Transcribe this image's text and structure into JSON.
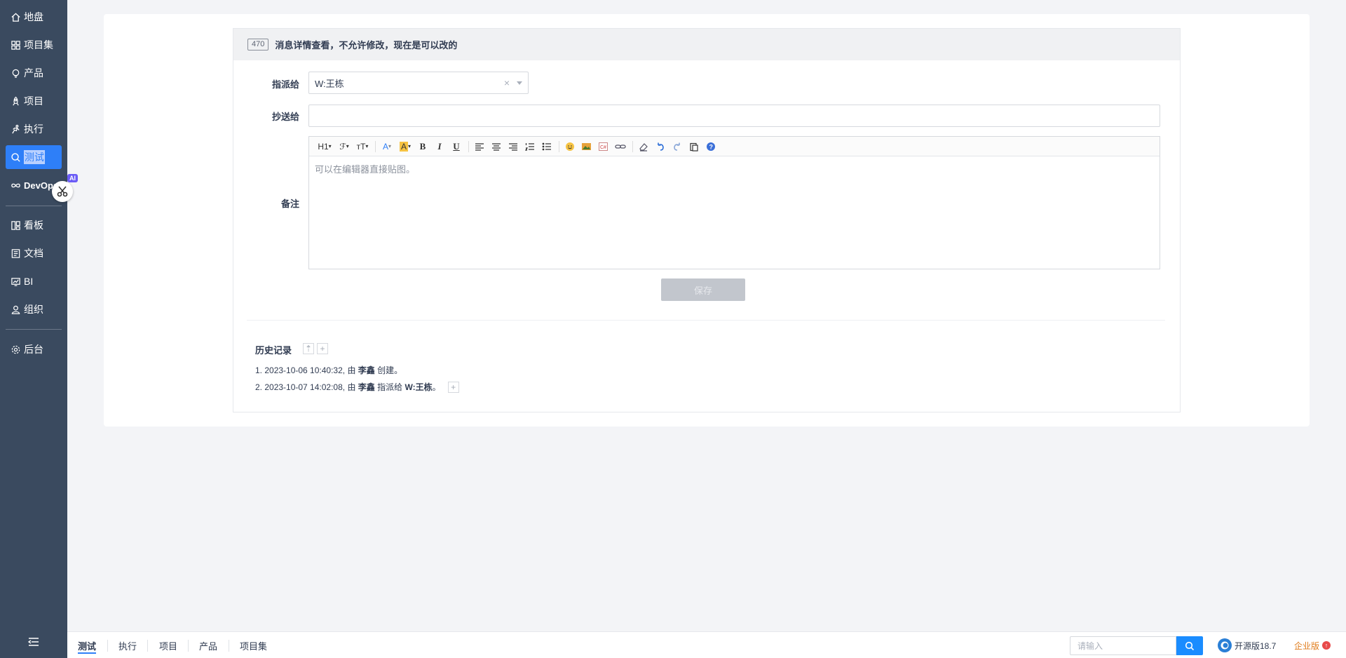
{
  "sidebar": {
    "items": [
      {
        "label": "地盘",
        "icon": "home-icon"
      },
      {
        "label": "项目集",
        "icon": "grid-icon"
      },
      {
        "label": "产品",
        "icon": "lightbulb-icon"
      },
      {
        "label": "项目",
        "icon": "rocket-icon"
      },
      {
        "label": "执行",
        "icon": "run-icon"
      },
      {
        "label": "测试",
        "icon": "search-icon"
      },
      {
        "label": "DevOps",
        "icon": "infinity-icon"
      },
      {
        "label": "看板",
        "icon": "kanban-icon"
      },
      {
        "label": "文档",
        "icon": "doc-icon"
      },
      {
        "label": "BI",
        "icon": "chart-icon"
      },
      {
        "label": "组织",
        "icon": "user-icon"
      },
      {
        "label": "后台",
        "icon": "gear-icon"
      }
    ],
    "ai_tag": "AI",
    "active_color": "#2e7ff8"
  },
  "detail": {
    "id": "470",
    "title": "消息详情查看，不允许修改，现在是可以改的"
  },
  "form": {
    "assign_label": "指派给",
    "assign_value": "W:王栋",
    "cc_label": "抄送给",
    "remark_label": "备注",
    "editor_placeholder": "可以在编辑器直接贴图。",
    "save_label": "保存"
  },
  "history": {
    "title": "历史记录",
    "entries": [
      {
        "prefix": "1. 2023-10-06 10:40:32, 由 ",
        "user": "李鑫",
        "suffix": " 创建。"
      },
      {
        "prefix": "2. 2023-10-07 14:02:08, 由 ",
        "user": "李鑫",
        "mid": " 指派给 ",
        "target": "W:王栋",
        "suffix": "。"
      }
    ]
  },
  "bottombar": {
    "crumbs": [
      "测试",
      "执行",
      "项目",
      "产品",
      "项目集"
    ],
    "search_placeholder": "请输入",
    "version": "开源版18.7",
    "enterprise": "企业版"
  }
}
